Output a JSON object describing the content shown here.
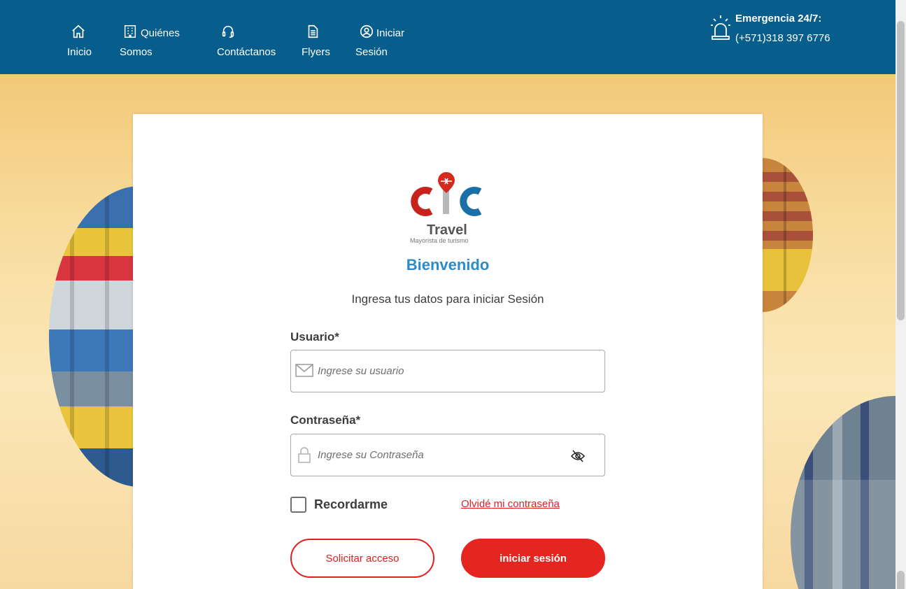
{
  "header": {
    "nav": [
      {
        "label": "Inicio",
        "icon": "home-icon"
      },
      {
        "label": "Quiénes",
        "label2": "Somos",
        "icon": "building-icon"
      },
      {
        "label": "Contáctanos",
        "icon": "headset-icon"
      },
      {
        "label": "Flyers",
        "icon": "document-icon"
      },
      {
        "label": "Iniciar",
        "label2": "Sesión",
        "icon": "user-circle-icon"
      }
    ],
    "emergency_title": "Emergencia 24/7:",
    "emergency_phone": "(+571)318 397 6776",
    "emergency_icon": "siren-icon"
  },
  "logo": {
    "brand": "CIC",
    "name": "Travel",
    "tagline": "Mayorista de turismo"
  },
  "login": {
    "welcome": "Bienvenido",
    "subtitle": "Ingresa tus datos para iniciar Sesión",
    "user_label": "Usuario*",
    "user_placeholder": "Ingrese su usuario",
    "password_label": "Contraseña*",
    "password_placeholder": "Ingrese su Contraseña",
    "remember_label": "Recordarme",
    "forgot_label": "Olvidé mi contraseña",
    "request_access_label": "Solicitar acceso",
    "login_label": "iniciar sesión"
  },
  "colors": {
    "header": "#075e8c",
    "accent_red": "#e52520",
    "accent_blue": "#2c8bc9"
  }
}
